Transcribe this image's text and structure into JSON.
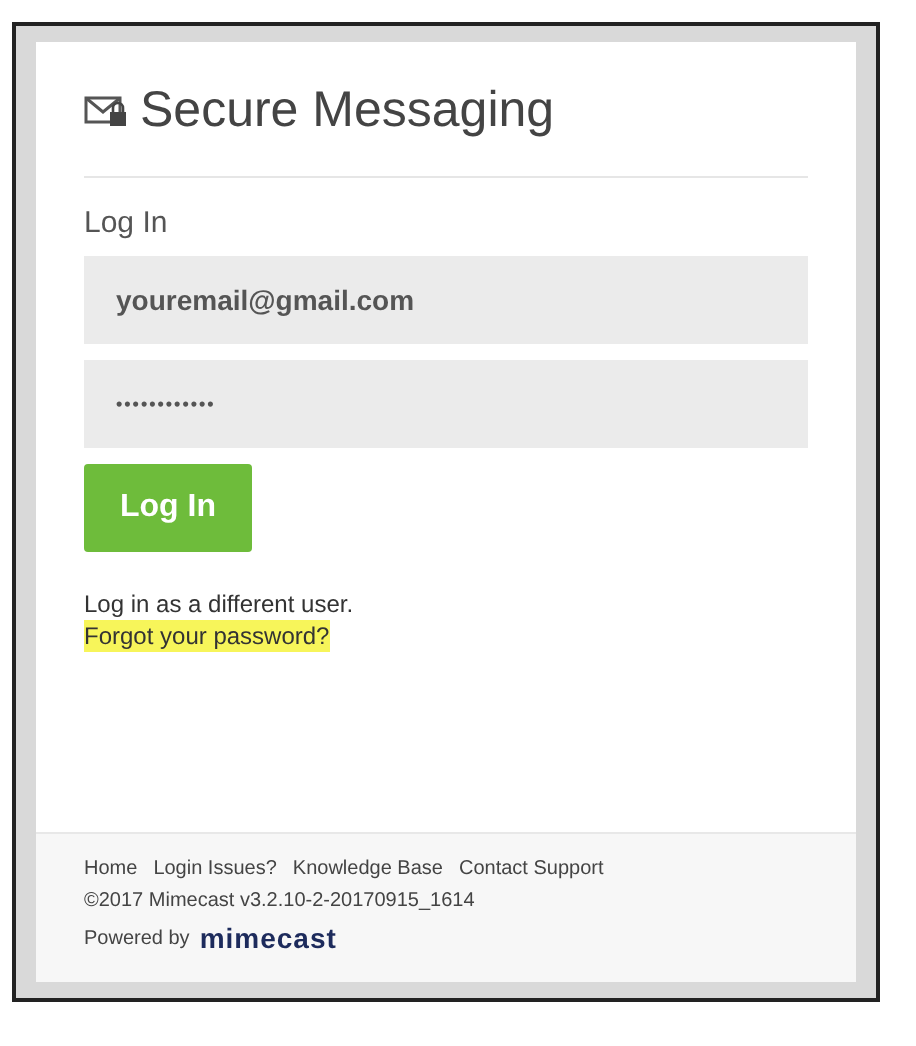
{
  "header": {
    "title": "Secure Messaging"
  },
  "form": {
    "heading": "Log In",
    "email": {
      "value": "youremail@gmail.com"
    },
    "password": {
      "value": "••••••••••••"
    },
    "submit": "Log In"
  },
  "links": [
    {
      "text": "Log in as a different user.",
      "highlighted": false
    },
    {
      "text": "Forgot your password?",
      "highlighted": true
    }
  ],
  "footer": {
    "nav": [
      "Home",
      "Login Issues?",
      "Knowledge Base",
      "Contact Support"
    ],
    "copyright": "©2017 Mimecast v3.2.10-2-20170915_1614",
    "powered_by": "Powered by",
    "logo": "mimecast"
  }
}
